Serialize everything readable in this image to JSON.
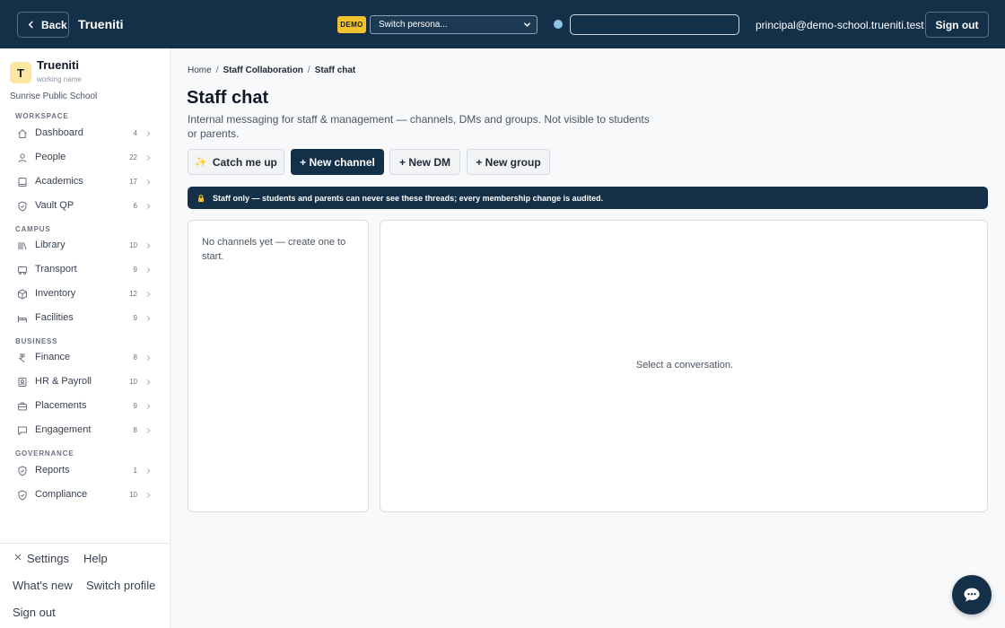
{
  "topbar": {
    "back_label": "Back",
    "brand": "Trueniti",
    "demo_badge": "DEMO",
    "persona_select": "Switch persona...",
    "search_value": "",
    "user_email": "principal@demo-school.trueniti.test",
    "signout_label": "Sign out"
  },
  "sidebar": {
    "logo_letter": "T",
    "brand_name": "Trueniti",
    "brand_sub": "working name",
    "school_name": "Sunrise Public School",
    "sections": {
      "workspace": "WORKSPACE",
      "campus": "CAMPUS",
      "business": "BUSINESS",
      "governance": "GOVERNANCE"
    },
    "items": [
      {
        "label": "Dashboard",
        "count": "4",
        "icon": "home-icon"
      },
      {
        "label": "People",
        "count": "22",
        "icon": "person-icon"
      },
      {
        "label": "Academics",
        "count": "17",
        "icon": "book-icon"
      },
      {
        "label": "Vault QP",
        "count": "6",
        "icon": "shield-check-icon"
      },
      {
        "label": "Library",
        "count": "10",
        "icon": "library-icon"
      },
      {
        "label": "Transport",
        "count": "9",
        "icon": "bus-icon"
      },
      {
        "label": "Inventory",
        "count": "12",
        "icon": "box-icon"
      },
      {
        "label": "Facilities",
        "count": "9",
        "icon": "bed-icon"
      },
      {
        "label": "Finance",
        "count": "8",
        "icon": "rupee-icon"
      },
      {
        "label": "HR & Payroll",
        "count": "10",
        "icon": "badge-icon"
      },
      {
        "label": "Placements",
        "count": "9",
        "icon": "briefcase-icon"
      },
      {
        "label": "Engagement",
        "count": "8",
        "icon": "message-icon"
      },
      {
        "label": "Reports",
        "count": "1",
        "icon": "shield-check-icon"
      },
      {
        "label": "Compliance",
        "count": "10",
        "icon": "shield-check-icon"
      }
    ],
    "footer": {
      "settings": "Settings",
      "help": "Help",
      "whats_new": "What's new",
      "switch_profile": "Switch profile",
      "sign_out": "Sign out"
    }
  },
  "main": {
    "breadcrumb": [
      "Home",
      "Staff Collaboration",
      "Staff chat"
    ],
    "title": "Staff chat",
    "description": "Internal messaging for staff & management — channels, DMs and groups. Not visible to students or parents.",
    "actions": {
      "catch_up": "Catch me up",
      "new_channel": "+ New channel",
      "new_dm": "+ New DM",
      "new_group": "+ New group"
    },
    "notice": "Staff only — students and parents can never see these threads; every membership change is audited.",
    "channels_empty": "No channels yet — create one to start.",
    "conversation_empty": "Select a conversation."
  },
  "colors": {
    "navy": "#143049",
    "demo_yellow": "#f2c12e",
    "logo_bg": "#fbe6a4"
  }
}
